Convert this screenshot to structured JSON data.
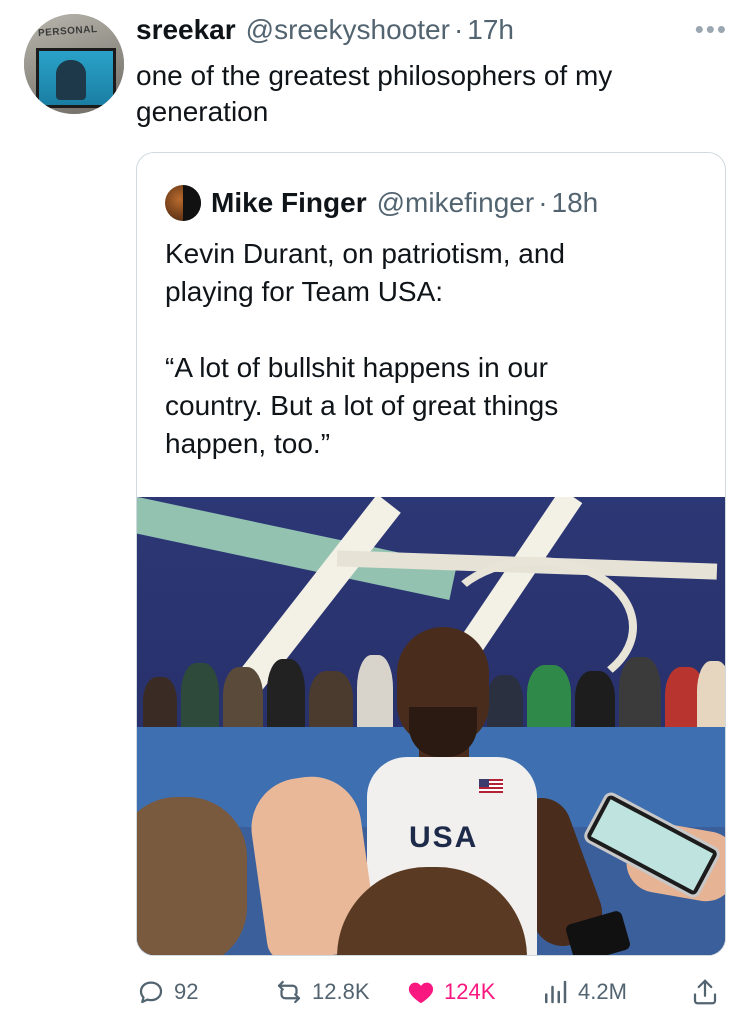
{
  "author": {
    "display_name": "sreekar",
    "handle": "@sreekyshooter",
    "separator": "·",
    "time": "17h",
    "avatar_tag": "PERSONAL"
  },
  "tweet": {
    "line1": "one of the greatest philosophers of my",
    "line2": "generation"
  },
  "quoted": {
    "display_name": "Mike Finger",
    "handle": "@mikefinger",
    "separator": "·",
    "time": "18h",
    "text_line1": "Kevin Durant, on patriotism, and",
    "text_line2": "playing for Team USA:",
    "quote_line1": "“A lot of bullshit happens in our",
    "quote_line2": "country. But a lot of great things",
    "quote_line3": "happen, too.”",
    "jersey_text": "USA"
  },
  "stats": {
    "replies": "92",
    "retweets": "12.8K",
    "likes": "124K",
    "views": "4.2M"
  },
  "colors": {
    "like_active": "#f91880",
    "secondary_text": "#536471",
    "border": "#cfd9de"
  },
  "icons": [
    "more-icon",
    "reply-icon",
    "retweet-icon",
    "heart-icon",
    "views-icon",
    "share-icon"
  ]
}
